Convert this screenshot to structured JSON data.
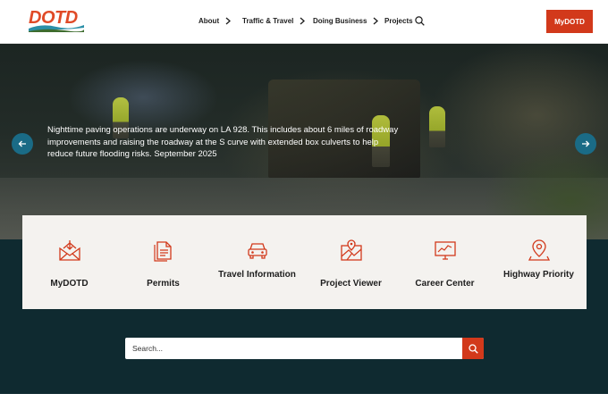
{
  "header": {
    "logo_text": "DOTD",
    "nav": [
      {
        "label": "About",
        "has_chevron": true
      },
      {
        "label": "Traffic & Travel",
        "has_chevron": true
      },
      {
        "label": "Doing Business",
        "has_chevron": true
      },
      {
        "label": "Projects",
        "has_chevron": false
      }
    ],
    "cta_label": "MyDOTD"
  },
  "hero": {
    "caption": "Nighttime paving operations are underway on LA 928. This includes about 6 miles of roadway improvements and raising the roadway at the S curve with extended box culverts to help reduce future flooding risks. September 2025"
  },
  "cards": [
    {
      "label": "MyDOTD",
      "icon": "envelope-download-icon"
    },
    {
      "label": "Permits",
      "icon": "document-icon"
    },
    {
      "label": "Travel Information",
      "icon": "car-icon"
    },
    {
      "label": "Project Viewer",
      "icon": "map-pin-icon"
    },
    {
      "label": "Career Center",
      "icon": "monitor-chart-icon"
    },
    {
      "label": "Highway Priority",
      "icon": "location-pin-icon"
    }
  ],
  "search": {
    "placeholder": "Search..."
  },
  "colors": {
    "accent": "#d2391b",
    "teal_button": "#1a6b86",
    "dark_bg": "#0f2a30",
    "card_bg": "#f4f2ef"
  }
}
